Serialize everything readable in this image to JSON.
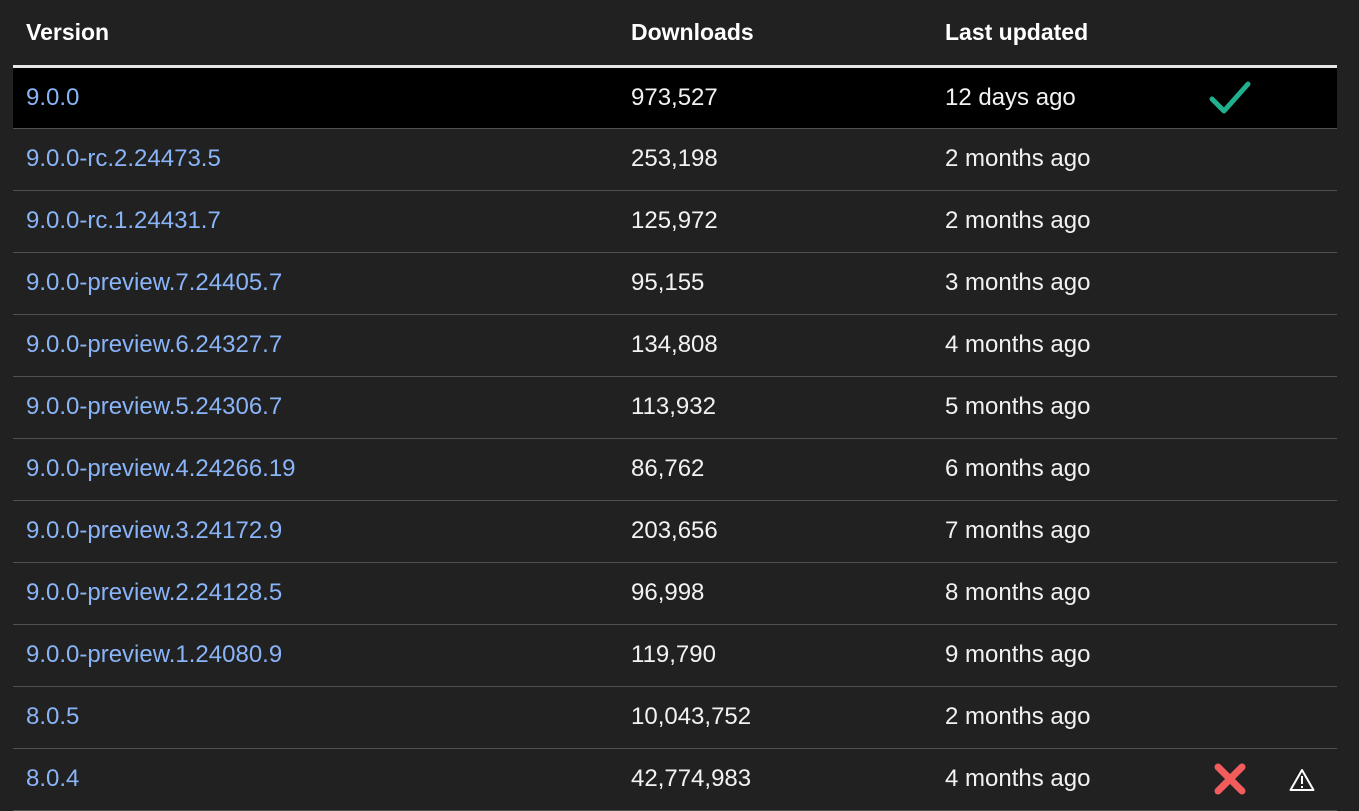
{
  "headers": {
    "version": "Version",
    "downloads": "Downloads",
    "last_updated": "Last updated"
  },
  "rows": [
    {
      "version": "9.0.0",
      "downloads": "973,527",
      "last_updated": "12 days ago",
      "current": true,
      "flags": [
        "checkmark-icon"
      ]
    },
    {
      "version": "9.0.0-rc.2.24473.5",
      "downloads": "253,198",
      "last_updated": "2 months ago"
    },
    {
      "version": "9.0.0-rc.1.24431.7",
      "downloads": "125,972",
      "last_updated": "2 months ago"
    },
    {
      "version": "9.0.0-preview.7.24405.7",
      "downloads": "95,155",
      "last_updated": "3 months ago"
    },
    {
      "version": "9.0.0-preview.6.24327.7",
      "downloads": "134,808",
      "last_updated": "4 months ago"
    },
    {
      "version": "9.0.0-preview.5.24306.7",
      "downloads": "113,932",
      "last_updated": "5 months ago"
    },
    {
      "version": "9.0.0-preview.4.24266.19",
      "downloads": "86,762",
      "last_updated": "6 months ago"
    },
    {
      "version": "9.0.0-preview.3.24172.9",
      "downloads": "203,656",
      "last_updated": "7 months ago"
    },
    {
      "version": "9.0.0-preview.2.24128.5",
      "downloads": "96,998",
      "last_updated": "8 months ago"
    },
    {
      "version": "9.0.0-preview.1.24080.9",
      "downloads": "119,790",
      "last_updated": "9 months ago"
    },
    {
      "version": "8.0.5",
      "downloads": "10,043,752",
      "last_updated": "2 months ago"
    },
    {
      "version": "8.0.4",
      "downloads": "42,774,983",
      "last_updated": "4 months ago",
      "flags": [
        "red-x-icon",
        "warning-triangle-icon"
      ]
    }
  ],
  "colors": {
    "background": "#212121",
    "current_row_background": "#000000",
    "link": "#8ab4f8",
    "checkmark": "#20b08e",
    "red_x": "#f25c5c"
  }
}
